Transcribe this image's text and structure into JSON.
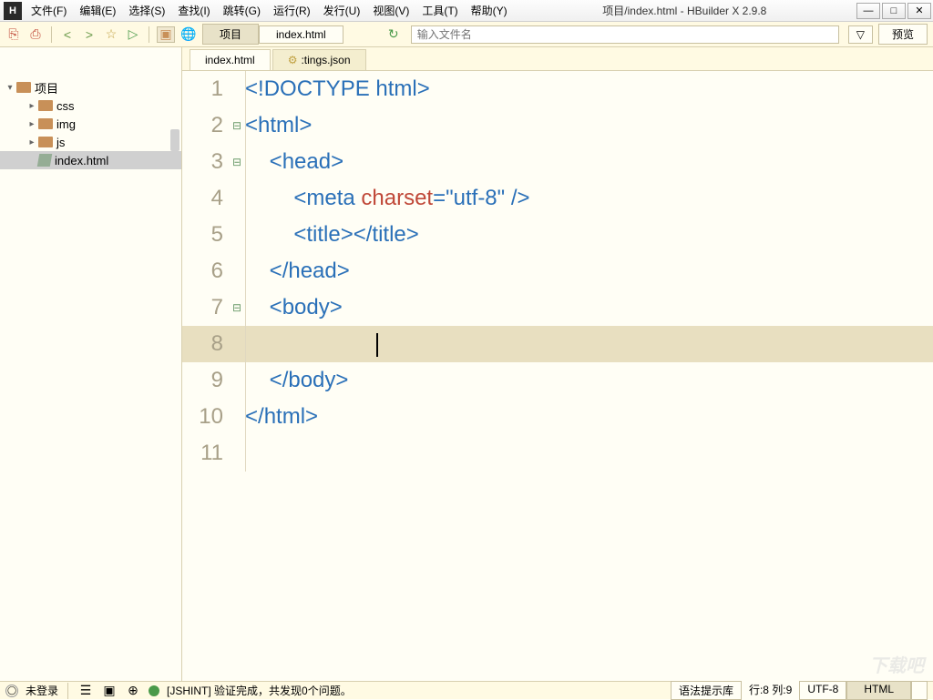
{
  "app_icon": "H",
  "menus": [
    "文件(F)",
    "编辑(E)",
    "选择(S)",
    "查找(I)",
    "跳转(G)",
    "运行(R)",
    "发行(U)",
    "视图(V)",
    "工具(T)",
    "帮助(Y)"
  ],
  "title": "项目/index.html - HBuilder X 2.9.8",
  "win": {
    "min": "—",
    "max": "□",
    "close": "✕"
  },
  "toolbar": {
    "new": "⎘",
    "save": "⎙",
    "back": "<",
    "fwd": ">",
    "star": "☆",
    "run": "▷",
    "folder": "▣",
    "browser": "🌐",
    "bc1": "项目",
    "bc2": "index.html",
    "refresh": "↻",
    "search_placeholder": "输入文件名",
    "filter": "▽",
    "preview": "预览"
  },
  "tree": {
    "root": "项目",
    "items": [
      {
        "name": "css",
        "icon": "folder",
        "indent": 28
      },
      {
        "name": "img",
        "icon": "folder",
        "indent": 28
      },
      {
        "name": "js",
        "icon": "folder",
        "indent": 28
      },
      {
        "name": "index.html",
        "icon": "file",
        "indent": 28,
        "selected": true
      }
    ]
  },
  "tabs": [
    {
      "label": "index.html",
      "active": true
    },
    {
      "label": ":tings.json",
      "active": false,
      "gear": true
    }
  ],
  "code": {
    "lines": [
      {
        "n": 1,
        "fold": "",
        "html": "<span class='c-punct'>&lt;!</span><span class='c-tag'>DOCTYPE</span> <span class='c-tag'>html</span><span class='c-punct'>&gt;</span>"
      },
      {
        "n": 2,
        "fold": "⊟",
        "html": "<span class='c-punct'>&lt;</span><span class='c-tag'>html</span><span class='c-punct'>&gt;</span>"
      },
      {
        "n": 3,
        "fold": "⊟",
        "html": "    <span class='c-punct'>&lt;</span><span class='c-tag'>head</span><span class='c-punct'>&gt;</span>"
      },
      {
        "n": 4,
        "fold": "",
        "html": "        <span class='c-punct'>&lt;</span><span class='c-tag'>meta</span> <span class='c-attr'>charset</span><span class='c-punct'>=</span><span class='c-str'>\"utf-8\"</span> <span class='c-punct'>/&gt;</span>"
      },
      {
        "n": 5,
        "fold": "",
        "html": "        <span class='c-punct'>&lt;</span><span class='c-tag'>title</span><span class='c-punct'>&gt;&lt;/</span><span class='c-tag'>title</span><span class='c-punct'>&gt;</span>"
      },
      {
        "n": 6,
        "fold": "",
        "html": "    <span class='c-punct'>&lt;/</span><span class='c-tag'>head</span><span class='c-punct'>&gt;</span>"
      },
      {
        "n": 7,
        "fold": "⊟",
        "html": "    <span class='c-punct'>&lt;</span><span class='c-tag'>body</span><span class='c-punct'>&gt;</span>"
      },
      {
        "n": 8,
        "fold": "",
        "html": "",
        "hl": true,
        "cursor": true
      },
      {
        "n": 9,
        "fold": "",
        "html": "    <span class='c-punct'>&lt;/</span><span class='c-tag'>body</span><span class='c-punct'>&gt;</span>"
      },
      {
        "n": 10,
        "fold": "",
        "html": "<span class='c-punct'>&lt;/</span><span class='c-tag'>html</span><span class='c-punct'>&gt;</span>"
      },
      {
        "n": 11,
        "fold": "",
        "html": ""
      }
    ]
  },
  "status": {
    "login": "未登录",
    "jshint": "[JSHINT] 验证完成，共发现0个问题。",
    "syntax": "语法提示库",
    "pos": "行:8 列:9",
    "encoding": "UTF-8",
    "lang": "HTML"
  },
  "watermark": "下载吧"
}
